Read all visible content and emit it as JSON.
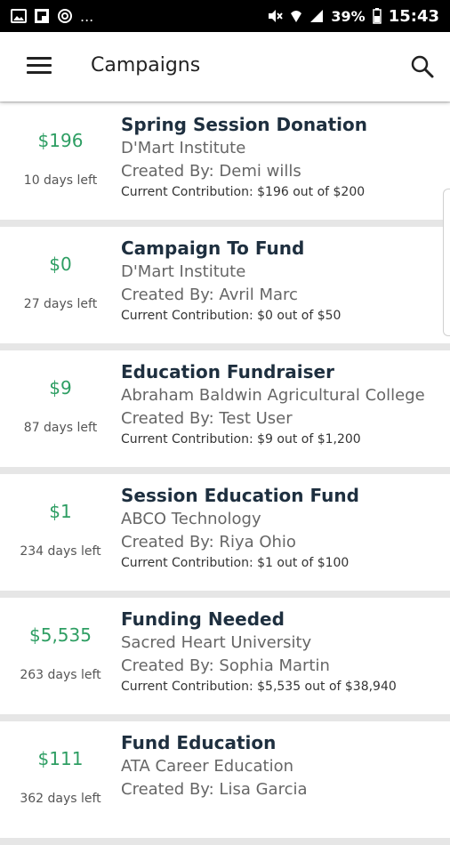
{
  "status_bar": {
    "notif_more": "...",
    "battery": "39%",
    "time": "15:43"
  },
  "app_bar": {
    "title": "Campaigns",
    "menu_icon": "hamburger-menu-icon",
    "search_icon": "search-icon"
  },
  "campaigns": [
    {
      "amount": "$196",
      "days_left": "10 days left",
      "title": "Spring Session Donation",
      "org": "D'Mart Institute",
      "created_by": "Created By: Demi wills",
      "contribution": "Current Contribution: $196 out of $200"
    },
    {
      "amount": "$0",
      "days_left": "27 days left",
      "title": "Campaign To Fund",
      "org": "D'Mart Institute",
      "created_by": "Created By: Avril Marc",
      "contribution": "Current Contribution: $0 out of $50"
    },
    {
      "amount": "$9",
      "days_left": "87 days left",
      "title": "Education Fundraiser",
      "org": "Abraham Baldwin Agricultural College",
      "created_by": "Created By: Test User",
      "contribution": "Current Contribution: $9 out of $1,200"
    },
    {
      "amount": "$1",
      "days_left": "234 days left",
      "title": "Session Education Fund",
      "org": "ABCO Technology",
      "created_by": "Created By: Riya Ohio",
      "contribution": "Current Contribution: $1 out of $100"
    },
    {
      "amount": "$5,535",
      "days_left": "263 days left",
      "title": "Funding Needed",
      "org": "Sacred Heart University",
      "created_by": "Created By: Sophia Martin",
      "contribution": "Current Contribution: $5,535 out of $38,940"
    },
    {
      "amount": "$111",
      "days_left": "362 days left",
      "title": "Fund Education",
      "org": "ATA Career Education",
      "created_by": "Created By: Lisa Garcia",
      "contribution": ""
    }
  ],
  "colors": {
    "accent_green": "#2e9e63",
    "title_dark": "#1e2f3f",
    "statusbar_bg": "#000000"
  }
}
